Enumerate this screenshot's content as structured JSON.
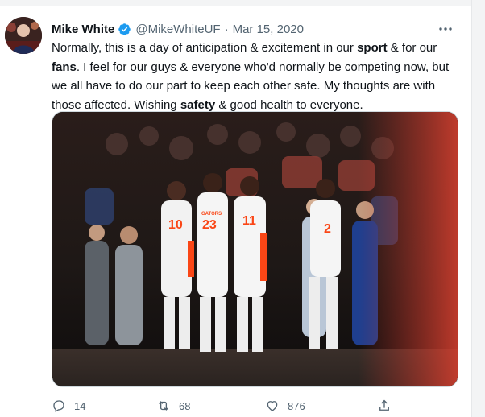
{
  "tweet": {
    "author_name": "Mike White",
    "handle": "@MikeWhiteUF",
    "separator": "·",
    "date": "Mar 15, 2020",
    "more_label": "···",
    "text_parts": [
      "Normally, this is a day of anticipation & excitement in our ",
      "sport",
      " & for our ",
      "fans",
      ". I feel for our guys & everyone who'd normally be competing now, but we all have to do our part to keep each other safe. My thoughts are with those affected. Wishing ",
      "safety",
      " & good health to everyone."
    ],
    "jersey_numbers": [
      "10",
      "23",
      "11",
      "2"
    ],
    "jersey_text": "GATORS"
  },
  "actions": {
    "reply_count": "14",
    "retweet_count": "68",
    "like_count": "876"
  },
  "icons": {
    "verified": "verified-badge-icon",
    "more": "more-icon",
    "reply": "reply-icon",
    "retweet": "retweet-icon",
    "like": "like-icon",
    "share": "share-icon"
  },
  "colors": {
    "verified": "#1d9bf0",
    "text": "#0f1419",
    "secondary": "#536471",
    "uniform": "#ffffff",
    "gators_orange": "#fa4616",
    "gators_blue": "#0021a5"
  }
}
